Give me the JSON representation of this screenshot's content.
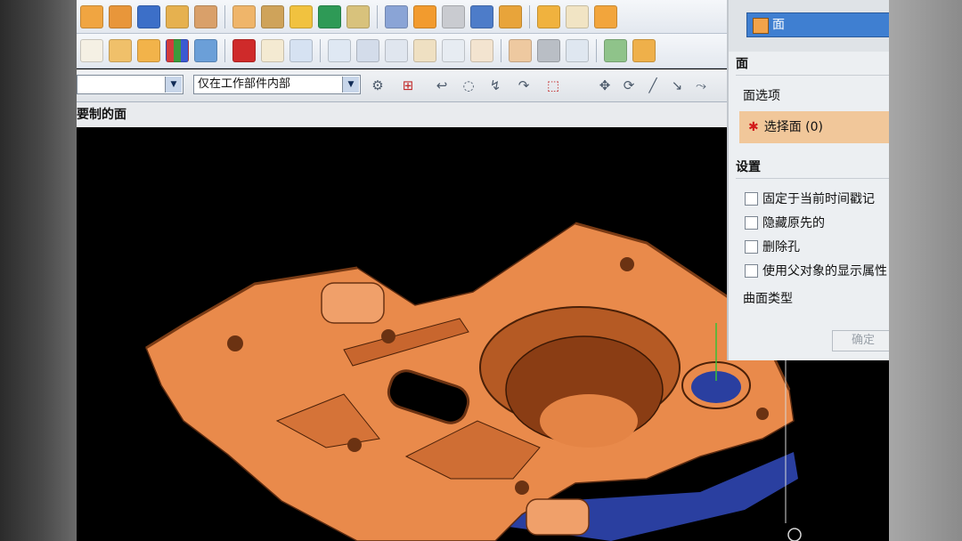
{
  "row3": {
    "combo1_value": "",
    "combo2_value": "仅在工作部件内部"
  },
  "viewport": {
    "title": "要制的面"
  },
  "dialog": {
    "type_value": "面",
    "face_section": "面",
    "face_options_label": "面选项",
    "select_face_label": "选择面 (0)",
    "settings_section": "设置",
    "checkboxes": [
      {
        "label": "固定于当前时间戳记",
        "checked": false
      },
      {
        "label": "隐藏原先的",
        "checked": false
      },
      {
        "label": "删除孔",
        "checked": false
      },
      {
        "label": "使用父对象的显示属性",
        "checked": false
      }
    ],
    "surface_type_label": "曲面类型",
    "ok_label": "确定"
  },
  "colors": {
    "part_orange": "#e98a4b",
    "part_blue": "#2a3fa0",
    "selection_highlight": "#f1c79a",
    "dialog_accent": "#3f7fd1"
  },
  "icons": {
    "toolbar_row1": [
      "extrude-icon",
      "revolve-icon",
      "block-icon",
      "hole-icon",
      "boss-icon",
      "pattern-icon",
      "mirror-icon",
      "unite-icon",
      "shell-icon",
      "blend-icon",
      "chamfer-icon",
      "offset-icon",
      "trim-icon",
      "draft-icon",
      "thicken-icon",
      "sew-icon",
      "patch-icon",
      "replace-icon"
    ],
    "toolbar_row2": [
      "delete-face-icon",
      "box-icon",
      "cube-icon",
      "color-palette-icon",
      "brush-icon",
      "solid-cube-icon",
      "frame-icon",
      "pipe-icon",
      "split-face-icon",
      "extract-icon",
      "cylinder-icon",
      "point-icon",
      "datum-csys-icon",
      "cross-icon",
      "plane-icon",
      "gray-swatch-icon",
      "camera-icon",
      "clip-icon",
      "layer-icon"
    ]
  }
}
